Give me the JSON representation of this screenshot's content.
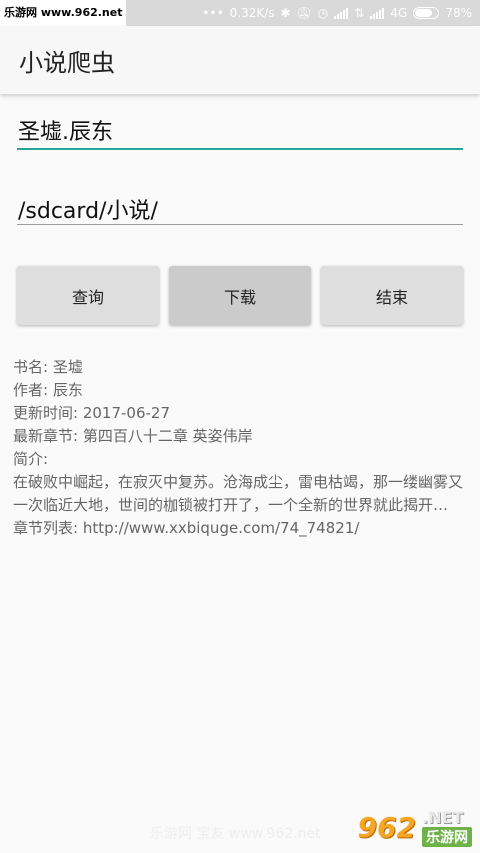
{
  "status_bar": {
    "watermark_tag": "乐游网 www.962.net",
    "speed": "0.32K/s",
    "network": "4G",
    "battery": "78%",
    "battery_level": 0.78
  },
  "app_bar": {
    "title": "小说爬虫"
  },
  "form": {
    "book_input": "圣墟.辰东",
    "path_input": "/sdcard/小说/"
  },
  "buttons": {
    "query": "查询",
    "download": "下载",
    "end": "结束"
  },
  "info": {
    "book_name": "书名: 圣墟",
    "author": "作者: 辰东",
    "update_time": "更新时间: 2017-06-27",
    "latest_chapter": "最新章节: 第四百八十二章 英姿伟岸",
    "intro_label": "简介:",
    "intro_text": "在破败中崛起，在寂灭中复苏。沧海成尘，雷电枯竭，那一缕幽雾又一次临近大地，世间的枷锁被打开了，一个全新的世界就此揭开…",
    "chapter_list": "章节列表: http://www.xxbiquge.com/74_74821/"
  },
  "watermark": {
    "big": "962",
    "net": ".NET",
    "cn": "乐游网",
    "ghost": "乐游网 宝友 www.962.net"
  },
  "colors": {
    "accent": "#26a69a",
    "button": "#dedede",
    "button_pressed": "#cbcbcb",
    "status_bar": "#d9d9d9"
  },
  "icons": [
    "dots-icon",
    "bluetooth-icon",
    "mute-icon",
    "alarm-icon",
    "signal-icon",
    "data-icon",
    "battery-icon"
  ]
}
